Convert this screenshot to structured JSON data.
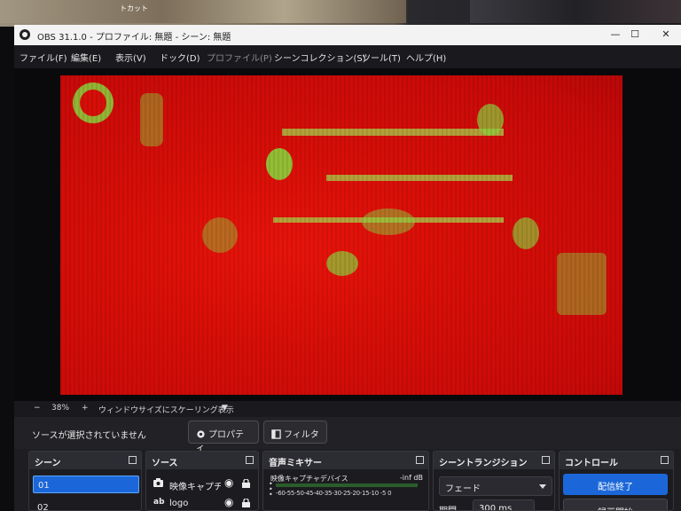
{
  "desktop": {
    "caption": "トカット"
  },
  "window": {
    "title": "OBS 31.1.0 - プロファイル: 無題 - シーン: 無題",
    "minimize_glyph": "—",
    "maximize_glyph": "☐",
    "close_glyph": "✕"
  },
  "menu": [
    {
      "label": "ファイル(F)"
    },
    {
      "label": "編集(E)"
    },
    {
      "label": "表示(V)"
    },
    {
      "label": "ドック(D)"
    },
    {
      "label": "プロファイル(P)",
      "disabled": true
    },
    {
      "label": "シーンコレクション(S)"
    },
    {
      "label": "ツール(T)"
    },
    {
      "label": "ヘルプ(H)"
    }
  ],
  "zoom": {
    "minus": "−",
    "value": "38%",
    "plus": "+",
    "mode": "ウィンドウサイズにスケーリング表示",
    "dropdown_glyph": "▼"
  },
  "selection": {
    "none_text": "ソースが選択されていません",
    "properties_label": "プロパティ",
    "filters_label": "フィルタ"
  },
  "scenes": {
    "title": "シーン",
    "items": [
      "01",
      "02"
    ]
  },
  "sources": {
    "title": "ソース",
    "items": [
      {
        "icon": "camera-icon",
        "name": "映像キャプチャ"
      },
      {
        "icon": "text-icon",
        "name": "logo"
      }
    ]
  },
  "mixer": {
    "title": "音声ミキサー",
    "device": "映像キャプチャデバイス",
    "level": "-inf dB",
    "scale": "-60-55-50-45-40-35-30-25-20-15-10 -5  0"
  },
  "transition": {
    "title": "シーントランジション",
    "type": "フェード",
    "duration_label": "期間",
    "duration": "300 ms"
  },
  "controls": {
    "title": "コントロール",
    "stop_stream": "配信終了",
    "start_record": "録画開始"
  },
  "colors": {
    "accent": "#1b67d9",
    "preview_tint": "#d70e08",
    "overlay_green": "#8ad23c"
  }
}
